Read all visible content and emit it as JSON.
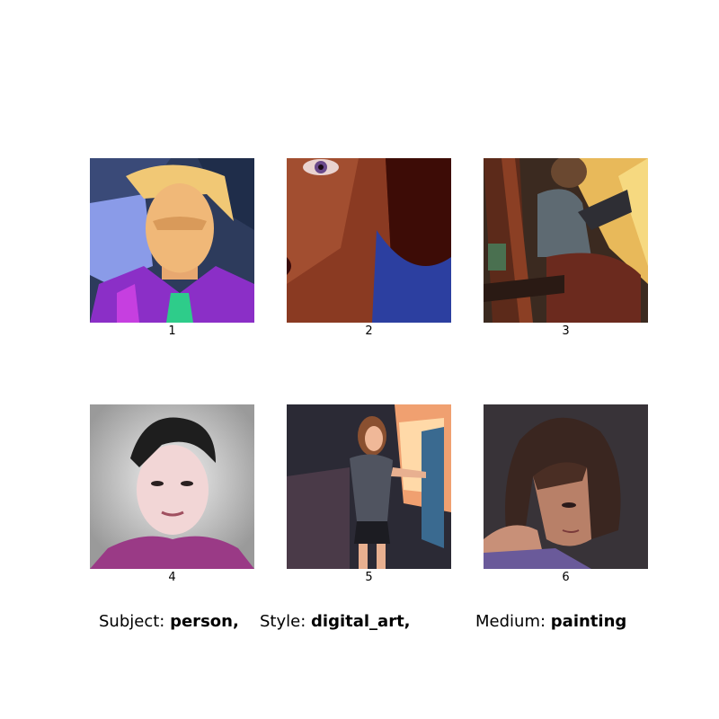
{
  "images": [
    {
      "number": "1",
      "description": "expressionist portrait of a blond person, purple top"
    },
    {
      "number": "2",
      "description": "close-up of a face with purple eye, dark hair"
    },
    {
      "number": "3",
      "description": "person sitting with tablet near easel"
    },
    {
      "number": "4",
      "description": "portrait of young man with black hair, purple shirt"
    },
    {
      "number": "5",
      "description": "woman painting at an easel in a studio"
    },
    {
      "number": "6",
      "description": "woman with dark bob haircut"
    }
  ],
  "caption": {
    "subject_label": "Subject:",
    "subject_value": "person,",
    "style_label": "Style:",
    "style_value": "digital_art,",
    "medium_label": "Medium:",
    "medium_value": "painting"
  }
}
